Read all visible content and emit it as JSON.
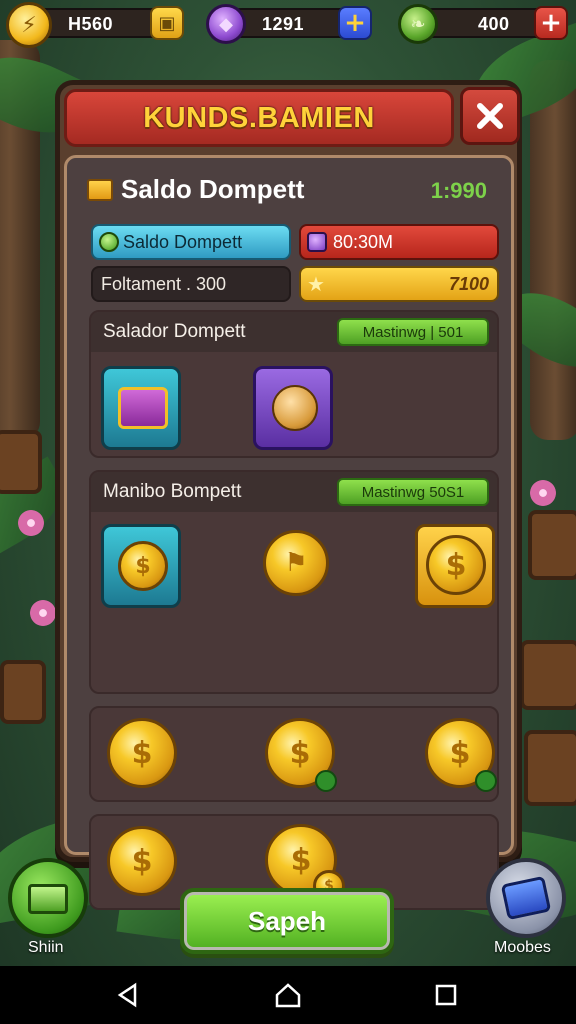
{
  "resources": [
    {
      "value": "H560",
      "icon": "lightning-coin-icon",
      "action_icon": "coin-add-icon"
    },
    {
      "value": "1291",
      "icon": "purple-gem-icon",
      "action_icon": "plus-icon"
    },
    {
      "value": "400",
      "icon": "green-leaf-icon",
      "action_icon": "plus-icon"
    }
  ],
  "panel": {
    "title": "KUNDS.BAMIEN",
    "wallet_label": "Saldo Dompett",
    "wallet_value": "1:990",
    "pill_blue": "Saldo Dompett",
    "pill_dark": "Foltament . 300",
    "pill_red": "80:30M",
    "pill_yellow": "7100"
  },
  "sections": [
    {
      "title": "Salador Dompett",
      "badge": "Mastinwg | 501"
    },
    {
      "title": "Manibo Bompett",
      "badge": "Mastinwg 50S1"
    }
  ],
  "buttons": {
    "save": "Sapeh",
    "shop": "Shiin",
    "modes": "Moobes"
  },
  "colors": {
    "accent_green": "#7dd14a",
    "title_gold": "#ffd23a",
    "close_red": "#c53a2e",
    "panel_brown": "#5a3f2e"
  }
}
